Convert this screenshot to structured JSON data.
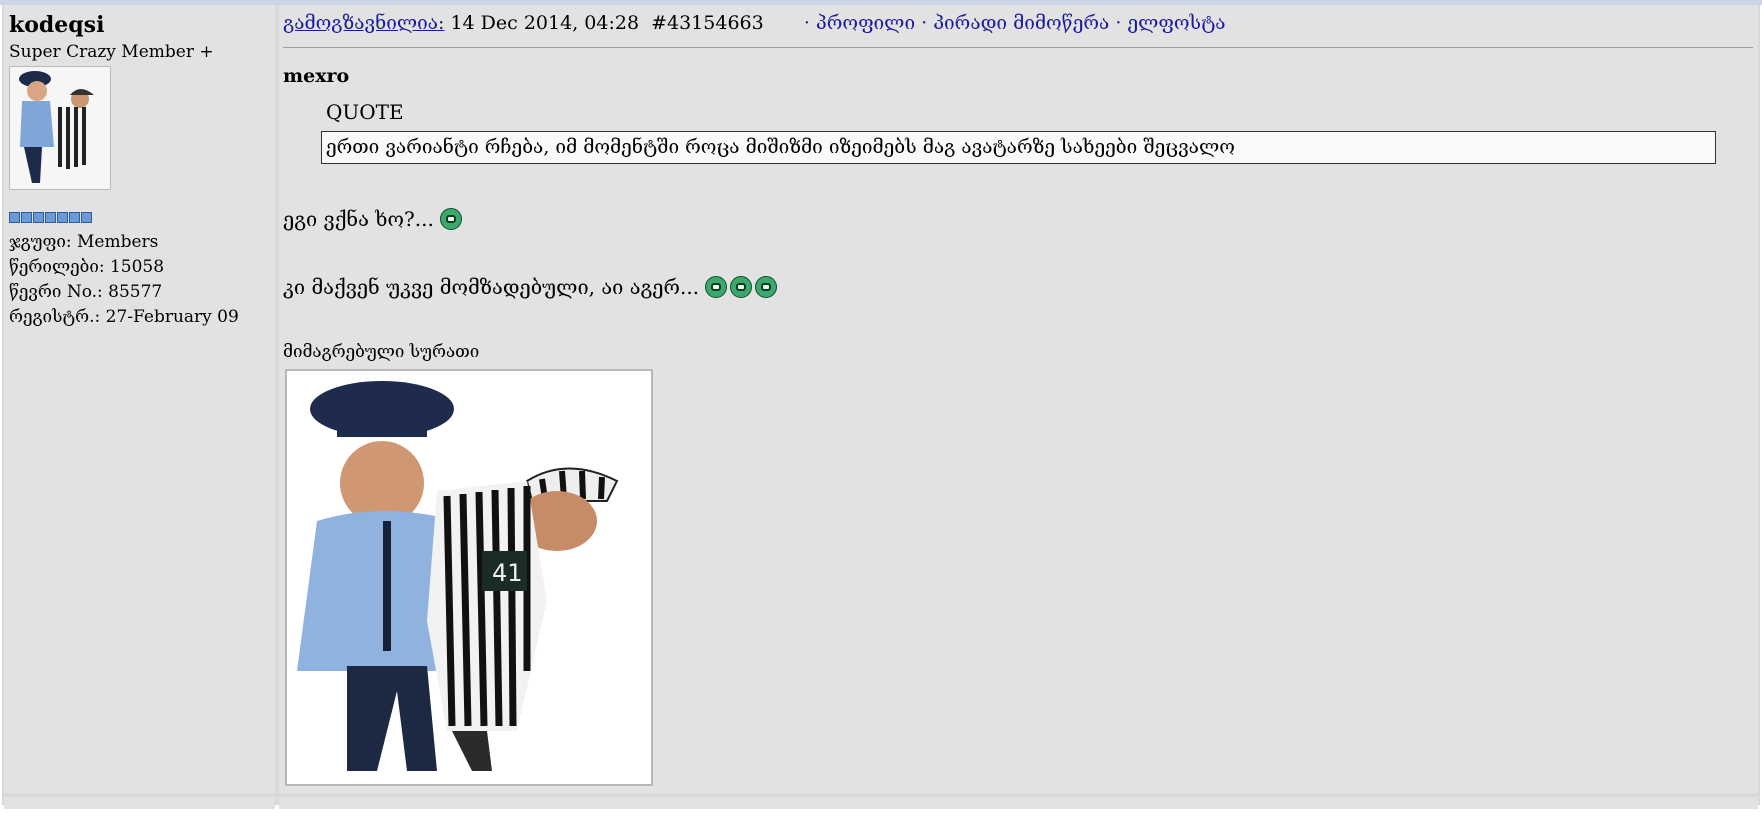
{
  "author": {
    "username": "kodeqsi",
    "title": "Super Crazy Member +",
    "pips": 7,
    "group": "ჯგუფი: Members",
    "posts": "წერილები: 15058",
    "member_no": "წევრი No.: 85577",
    "registered": "რეგისტრ.: 27-February 09"
  },
  "post": {
    "posted_label": "გამოგზავნილია:",
    "date": "14 Dec 2014, 04:28",
    "post_number": "#43154663",
    "links": [
      "პროფილი",
      "პირადი მიმოწერა",
      "ელფოსტა"
    ],
    "quote_author": "mexro",
    "quote_label": "QUOTE",
    "quote_text": "ერთი ვარიანტი რჩება, იმ მომენტში როცა მიშიზმი იზეიმებს მაგ ავატარზე სახეები შეცვალო",
    "line1": "ეგი ვქნა ხო?...",
    "line2": "კი მაქვენ უკვე მომზადებული, აი აგერ...",
    "attachment_label": "მიმაგრებული სურათი"
  },
  "colors": {
    "link": "#1a1aa0",
    "panel": "#e2e2e2",
    "pip": "#6d9ad6"
  }
}
